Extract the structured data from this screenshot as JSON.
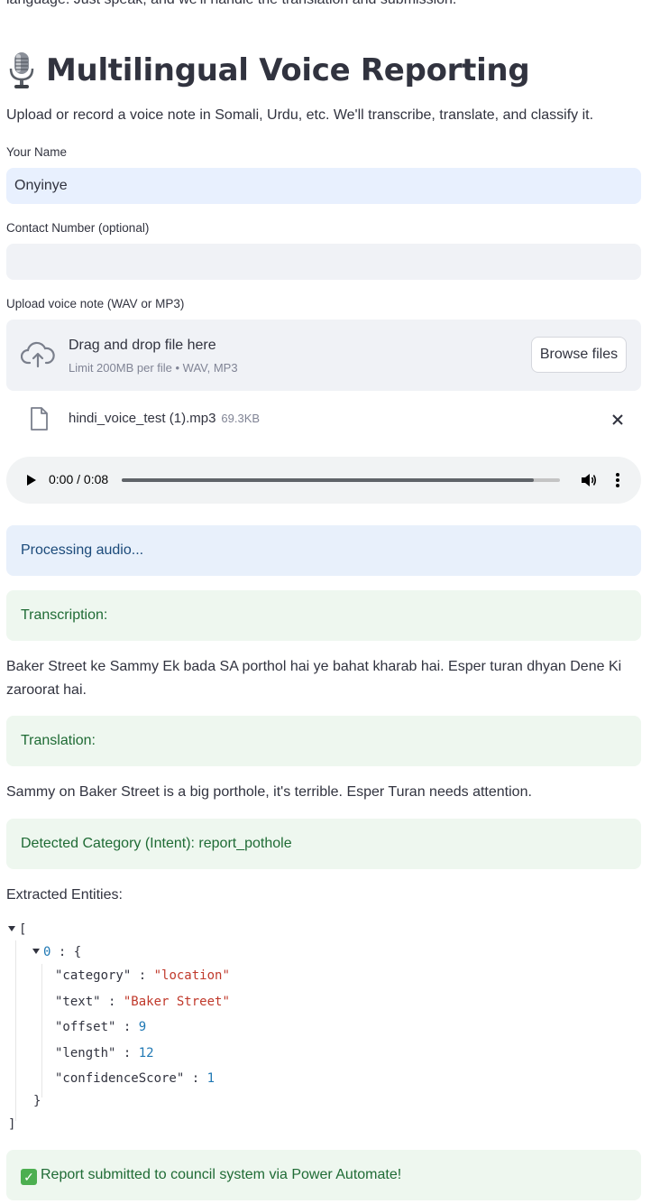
{
  "header": {
    "cut_text": "language. Just speak, and we'll handle the translation and submission.",
    "title": "Multilingual Voice Reporting",
    "subtitle": "Upload or record a voice note in Somali, Urdu, etc. We'll transcribe, translate, and classify it."
  },
  "form": {
    "name_label": "Your Name",
    "name_value": "Onyinye",
    "contact_label": "Contact Number (optional)",
    "contact_value": "",
    "upload_label": "Upload voice note (WAV or MP3)"
  },
  "uploader": {
    "title": "Drag and drop file here",
    "limit": "Limit 200MB per file • WAV, MP3",
    "browse_label": "Browse files",
    "file_name": "hindi_voice_test (1).mp3",
    "file_size": "69.3KB"
  },
  "audio": {
    "time": "0:00 / 0:08",
    "buffered_fraction": 0.94
  },
  "results": {
    "processing": "Processing audio...",
    "transcription_label": "Transcription:",
    "transcription": "Baker Street ke Sammy Ek bada SA porthol hai ye bahat kharab hai. Esper turan dhyan Dene Ki zaroorat hai.",
    "translation_label": "Translation:",
    "translation": "Sammy on Baker Street is a big porthole, it's terrible. Esper Turan needs attention.",
    "category": "Detected Category (Intent): report_pothole",
    "entities_label": "Extracted Entities:",
    "entities": {
      "open_bracket": "[",
      "close_bracket": "]",
      "index": "0",
      "obj_open": "{",
      "obj_close": "}",
      "k_category": "\"category\"",
      "v_category": "\"location\"",
      "k_text": "\"text\"",
      "v_text": "\"Baker Street\"",
      "k_offset": "\"offset\"",
      "v_offset": "9",
      "k_length": "\"length\"",
      "v_length": "12",
      "k_confidence": "\"confidenceScore\"",
      "v_confidence": "1"
    },
    "submitted": "Report submitted to council system via Power Automate!"
  },
  "colors": {
    "info_bg": "#e8f0fb",
    "success_bg": "#eef7ef",
    "input_bg": "#f0f2f6"
  }
}
